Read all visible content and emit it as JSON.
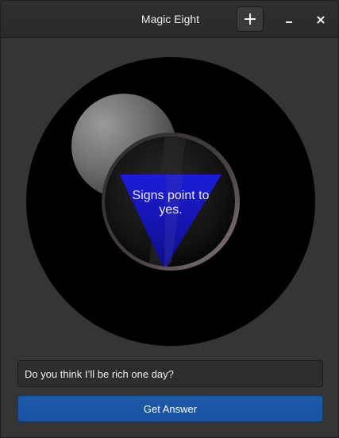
{
  "window": {
    "title": "Magic Eight"
  },
  "ball": {
    "answer": "Signs point to yes."
  },
  "question": {
    "value": "Do you think I’ll be rich one day?"
  },
  "actions": {
    "get_answer_label": "Get Answer"
  },
  "colors": {
    "accent": "#1a55a3",
    "triangle": "#1a1ad0",
    "ball": "#000000"
  }
}
